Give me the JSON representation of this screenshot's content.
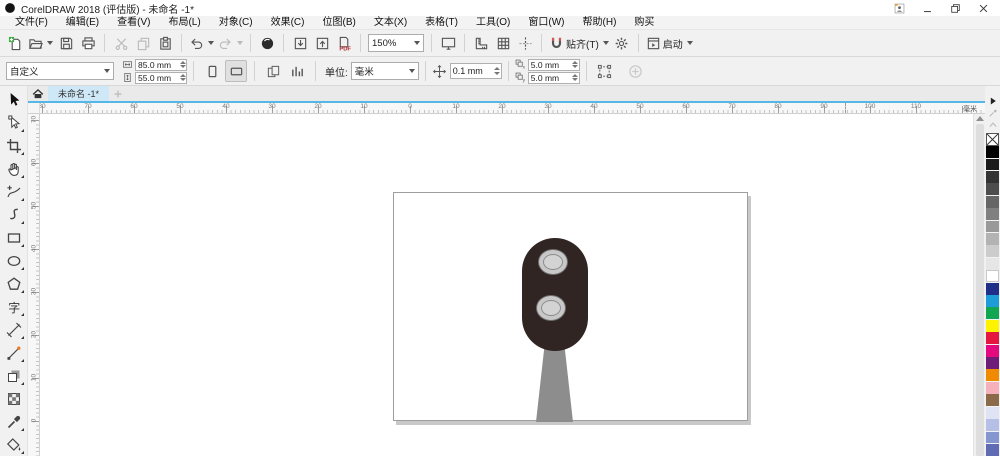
{
  "window": {
    "title": "CorelDRAW 2018 (评估版) - 未命名 -1*"
  },
  "menus": [
    "文件(F)",
    "编辑(E)",
    "查看(V)",
    "布局(L)",
    "对象(C)",
    "效果(C)",
    "位图(B)",
    "文本(X)",
    "表格(T)",
    "工具(O)",
    "窗口(W)",
    "帮助(H)",
    "购买"
  ],
  "toolbar": {
    "zoom_level": "150%",
    "items": [
      {
        "name": "new-document-button",
        "icon": "new"
      },
      {
        "name": "open-button",
        "icon": "open",
        "dropdown": true
      },
      {
        "name": "save-button",
        "icon": "save"
      },
      {
        "name": "print-button",
        "icon": "print"
      },
      {
        "sep": true
      },
      {
        "name": "cut-button",
        "icon": "cut",
        "disabled": true
      },
      {
        "name": "copy-button",
        "icon": "copy",
        "disabled": true
      },
      {
        "name": "paste-button",
        "icon": "paste"
      },
      {
        "sep": true
      },
      {
        "name": "undo-button",
        "icon": "undo",
        "dropdown": true
      },
      {
        "name": "redo-button",
        "icon": "redo",
        "dropdown": true,
        "disabled": true
      },
      {
        "sep": true
      },
      {
        "name": "search-content-button",
        "icon": "search"
      },
      {
        "sep": true
      },
      {
        "name": "import-button",
        "icon": "import"
      },
      {
        "name": "export-button",
        "icon": "export"
      },
      {
        "name": "publish-pdf-button",
        "icon": "pdf"
      },
      {
        "sep": true
      },
      {
        "zoom_combo": true
      },
      {
        "sep": true
      },
      {
        "name": "fullscreen-preview-button",
        "icon": "fullscreen"
      },
      {
        "sep": true
      },
      {
        "name": "show-rulers-button",
        "icon": "rulers"
      },
      {
        "name": "show-grid-button",
        "icon": "grid"
      },
      {
        "name": "show-guidelines-button",
        "icon": "guidelines"
      },
      {
        "sep": true
      },
      {
        "name": "snap-to-button",
        "icon": "snap",
        "label": "贴齐(T)",
        "dropdown": true
      },
      {
        "name": "options-button",
        "icon": "gear"
      },
      {
        "sep": true
      },
      {
        "name": "launch-button",
        "icon": "launch",
        "label": "启动",
        "dropdown": true
      }
    ]
  },
  "property_bar": {
    "preset": "自定义",
    "page_width": "85.0 mm",
    "page_height": "55.0 mm",
    "units_label": "单位:",
    "units_value": "毫米",
    "nudge_value": "0.1 mm",
    "duplicate_x": "5.0 mm",
    "duplicate_y": "5.0 mm"
  },
  "document_tab": {
    "label": "未命名 -1*"
  },
  "rulers": {
    "h_labels": [
      "80",
      "70",
      "60",
      "50",
      "40",
      "30",
      "20",
      "10",
      "0",
      "10",
      "20",
      "30",
      "40",
      "50",
      "60",
      "70",
      "80",
      "90",
      "100",
      "110"
    ],
    "v_labels": [
      "70",
      "60",
      "50",
      "40",
      "30",
      "20",
      "10",
      "0"
    ],
    "unit_label": "毫米"
  },
  "toolbox": [
    {
      "name": "pick-tool",
      "icon": "pick"
    },
    {
      "name": "shape-tool",
      "icon": "shape",
      "flyout": true
    },
    {
      "name": "crop-tool",
      "icon": "crop",
      "flyout": true
    },
    {
      "name": "pan-tool",
      "icon": "hand",
      "flyout": true
    },
    {
      "name": "freehand-tool",
      "icon": "freehand",
      "flyout": true
    },
    {
      "name": "artistic-media-tool",
      "icon": "curve",
      "flyout": true
    },
    {
      "name": "rectangle-tool",
      "icon": "rect",
      "flyout": true
    },
    {
      "name": "ellipse-tool",
      "icon": "ellipse",
      "flyout": true
    },
    {
      "name": "polygon-tool",
      "icon": "polygon",
      "flyout": true
    },
    {
      "name": "text-tool",
      "icon": "text",
      "flyout": true
    },
    {
      "name": "dimension-tool",
      "icon": "dimension",
      "flyout": true
    },
    {
      "name": "connector-tool",
      "icon": "connector",
      "flyout": true
    },
    {
      "name": "drop-shadow-tool",
      "icon": "shadow",
      "flyout": true
    },
    {
      "name": "transparency-tool",
      "icon": "transparency"
    },
    {
      "name": "eyedropper-tool",
      "icon": "eyedropper",
      "flyout": true
    },
    {
      "name": "interactive-fill-tool",
      "icon": "fill",
      "flyout": true
    }
  ],
  "palette": {
    "colors": [
      "#000000",
      "#1a1a1a",
      "#333333",
      "#4d4d4d",
      "#666666",
      "#808080",
      "#999999",
      "#b3b3b3",
      "#cccccc",
      "#e6e6e6",
      "#ffffff",
      "#1f2f87",
      "#1e9cd7",
      "#12a651",
      "#fdf300",
      "#e5173f",
      "#e5097f",
      "#6e1e78",
      "#f08a00",
      "#f5b0bc",
      "#8a6a49",
      "#dfe3f4",
      "#b6bfe6",
      "#8496cf",
      "#5f6cb3"
    ]
  },
  "artwork": {
    "body_color": "#302523",
    "pole_color": "#8d8d8d",
    "lamp_outer": "#c8c8c8",
    "lamp_inner": "#d3d3d3",
    "accent_tab_color": "#cfe8f7"
  }
}
